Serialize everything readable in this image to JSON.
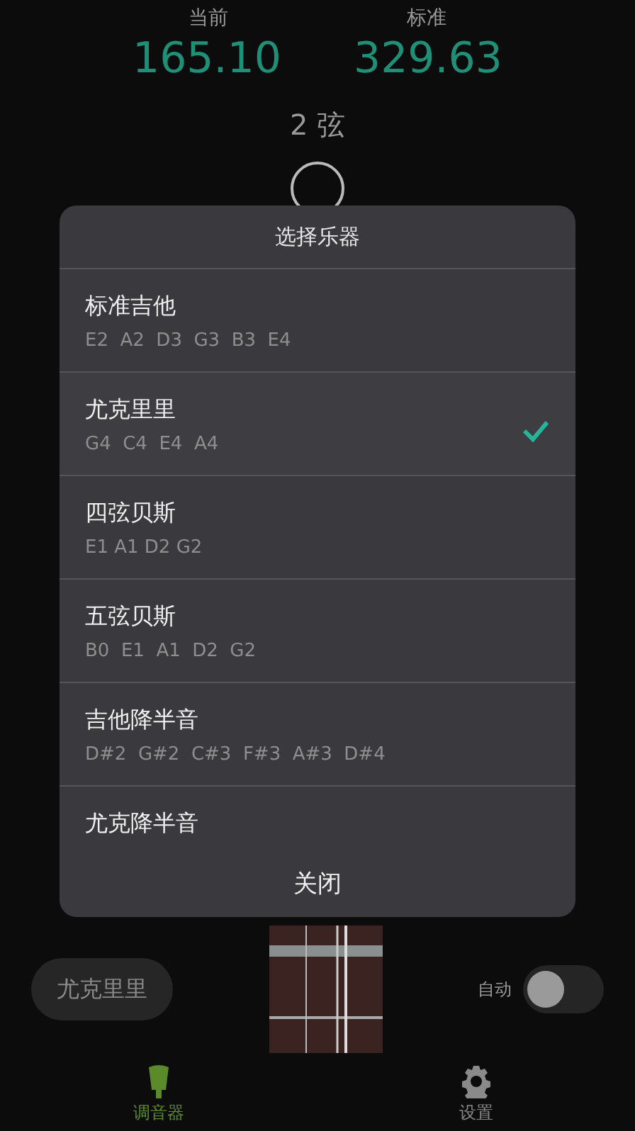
{
  "readout": {
    "current_label": "当前",
    "current_value": "165.10",
    "standard_label": "标准",
    "standard_value": "329.63",
    "string": "2 弦"
  },
  "dialog": {
    "title": "选择乐器",
    "instruments": [
      {
        "name": "标准吉他",
        "notes": "E2  A2  D3  G3  B3  E4",
        "selected": false
      },
      {
        "name": "尤克里里",
        "notes": "G4  C4  E4  A4",
        "selected": true
      },
      {
        "name": "四弦贝斯",
        "notes": "E1 A1 D2 G2",
        "selected": false
      },
      {
        "name": "五弦贝斯",
        "notes": "B0  E1  A1  D2  G2",
        "selected": false
      },
      {
        "name": "吉他降半音",
        "notes": "D#2  G#2  C#3  F#3  A#3  D#4",
        "selected": false
      },
      {
        "name": "尤克降半音",
        "selected": false
      }
    ],
    "close": "关闭"
  },
  "instrument_button": "尤克里里",
  "auto": {
    "label": "自动",
    "on": false
  },
  "nav": [
    {
      "label": "调音器",
      "kind": "tuner",
      "selected": true
    },
    {
      "label": "设置",
      "kind": "settings",
      "selected": false
    }
  ]
}
